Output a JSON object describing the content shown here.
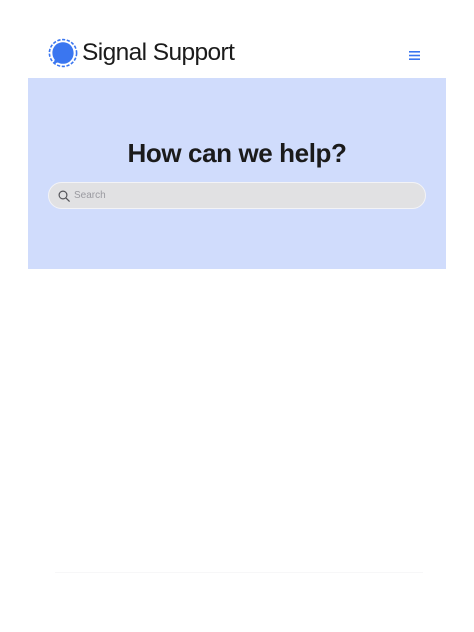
{
  "header": {
    "site_name": "Signal Support"
  },
  "hero": {
    "title": "How can we help?"
  },
  "search": {
    "placeholder": "Search",
    "value": ""
  },
  "colors": {
    "brand_blue": "#3a76f0",
    "hero_background": "#d0dcfc",
    "search_background": "#e1e1e3"
  },
  "icons": {
    "logo": "signal-logo-icon",
    "menu": "hamburger-menu-icon",
    "search": "search-icon"
  }
}
